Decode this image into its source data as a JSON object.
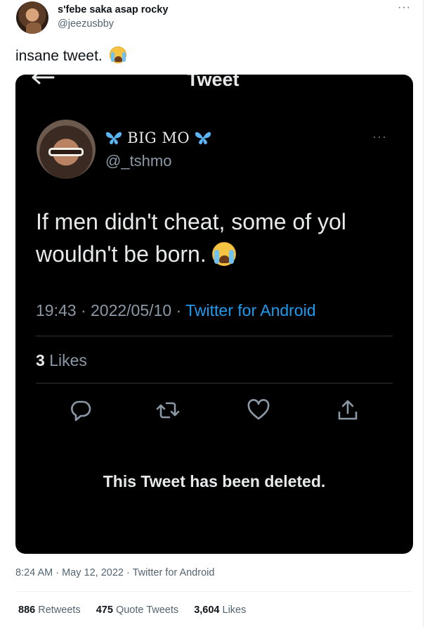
{
  "outer": {
    "author_name": "s'febe saka asap rocky",
    "author_handle": "@jeezusbby",
    "more_icon": "more-icon",
    "text": "insane tweet.",
    "text_emoji": "loudly-crying-face",
    "timestamp": "8:24 AM · May 12, 2022 · Twitter for Android",
    "stats": {
      "retweets_count": "886",
      "retweets_label": "Retweets",
      "quotes_count": "475",
      "quotes_label": "Quote Tweets",
      "likes_count": "3,604",
      "likes_label": "Likes"
    }
  },
  "screenshot": {
    "heading": "Tweet",
    "author_name": "BIG MO",
    "author_handle": "@_tshmo",
    "text": "If men didn't cheat, some of yol wouldn't be born.",
    "text_emoji": "loudly-crying-face",
    "time": "19:43 · 2022/05/10 · ",
    "source": "Twitter for Android",
    "likes_count": "3",
    "likes_label": "Likes",
    "deleted_notice": "This Tweet has been deleted.",
    "actions": [
      "reply-icon",
      "retweet-icon",
      "like-icon",
      "share-icon"
    ]
  },
  "colors": {
    "accent": "#1d9bf0",
    "butterfly": "#5ab4f5"
  }
}
